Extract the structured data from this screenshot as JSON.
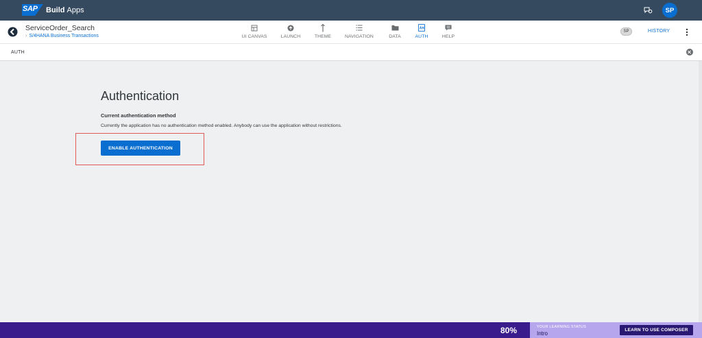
{
  "shell": {
    "logo_text": "SAP",
    "title_bold": "Build",
    "title_rest": "Apps",
    "avatar": "SP"
  },
  "app": {
    "name": "ServiceOrder_Search",
    "subtitle": "S/4HANA Business Transactions",
    "nav": [
      {
        "label": "UI CANVAS",
        "icon": "canvas-icon"
      },
      {
        "label": "LAUNCH",
        "icon": "launch-icon"
      },
      {
        "label": "THEME",
        "icon": "theme-icon"
      },
      {
        "label": "NAVIGATION",
        "icon": "navigation-icon"
      },
      {
        "label": "DATA",
        "icon": "data-icon"
      },
      {
        "label": "AUTH",
        "icon": "auth-icon",
        "active": true
      },
      {
        "label": "HELP",
        "icon": "help-icon"
      }
    ],
    "user_chip": "SP",
    "history_label": "HISTORY"
  },
  "subbar": {
    "label": "AUTH"
  },
  "main": {
    "title": "Authentication",
    "section_title": "Current authentication method",
    "description": "Currently the application has no authentication method enabled. Anybody can use the application without restrictions.",
    "enable_button": "ENABLE AUTHENTICATION"
  },
  "footer": {
    "percent": "80%",
    "status_title": "YOUR LEARNING STATUS",
    "status_value": "Intro",
    "cta": "LEARN TO USE COMPOSER"
  },
  "colors": {
    "shell": "#354a5f",
    "accent": "#0a6ed1",
    "highlight": "#e05a5a",
    "footer": "#3a1c8c",
    "footer_status": "#b5a6ee"
  }
}
